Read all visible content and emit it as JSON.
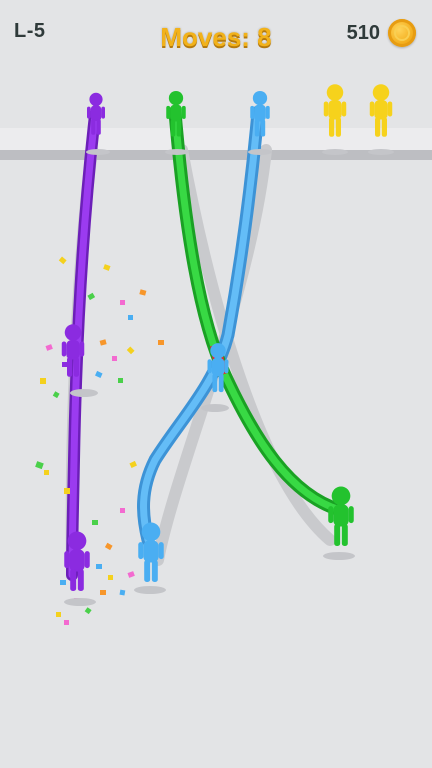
{
  "hud": {
    "level": "L-5",
    "moves_text": "Moves: 8",
    "coins": "510"
  },
  "icons": {
    "coin": "gold-coin-icon"
  },
  "colors": {
    "purple": "#8b2be0",
    "green": "#23c22e",
    "blue": "#4aaef2",
    "yellow": "#f6d21c",
    "red": "#e8282a"
  }
}
